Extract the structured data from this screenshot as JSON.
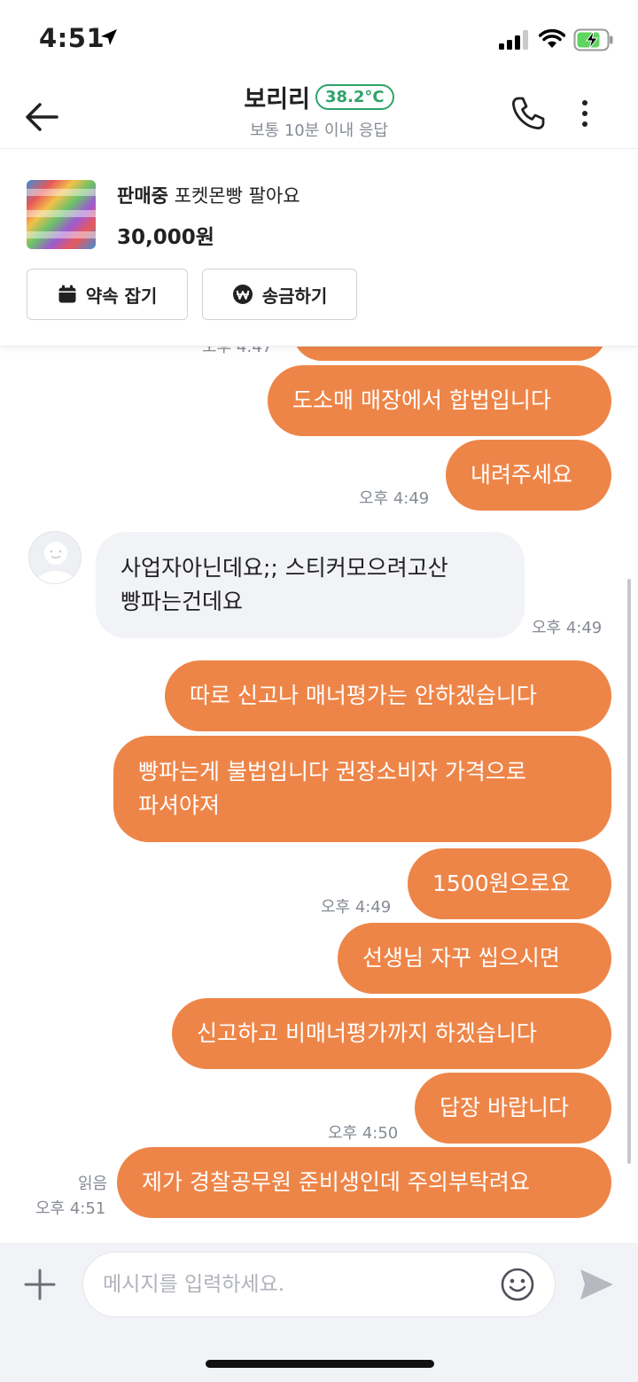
{
  "status_bar": {
    "time": "4:51"
  },
  "header": {
    "nickname": "보리리",
    "temperature": "38.2°C",
    "response_time": "보통 10분 이내 응답"
  },
  "product": {
    "status": "판매중",
    "title": "포켓몬빵 팔아요",
    "price": "30,000원",
    "appointment_label": "약속 잡기",
    "transfer_label": "송금하기"
  },
  "messages": [
    {
      "from": "me",
      "text": ""
    },
    {
      "from": "me",
      "text": "도소매 매장에서 합법입니다"
    },
    {
      "from": "me",
      "text": "내려주세요",
      "time": "오후 4:49"
    },
    {
      "from": "them",
      "text": "사업자아닌데요;; 스티커모으려고산\n빵파는건데요",
      "time": "오후 4:49"
    },
    {
      "from": "me",
      "text": "따로 신고나 매너평가는 안하겠습니다"
    },
    {
      "from": "me",
      "text": "빵파는게 불법입니다 권장소비자 가격으로\n파셔야져"
    },
    {
      "from": "me",
      "text": "1500원으로요",
      "time": "오후 4:49"
    },
    {
      "from": "me",
      "text": "선생님 자꾸 씹으시면"
    },
    {
      "from": "me",
      "text": "신고하고 비매너평가까지 하겠습니다"
    },
    {
      "from": "me",
      "text": "답장 바랍니다",
      "time": "오후 4:50"
    },
    {
      "from": "me",
      "text": "제가 경찰공무원 준비생인데 주의부탁려요",
      "time": "오후 4:51",
      "read": "읽음"
    }
  ],
  "partial_time_top": "오후 4:47",
  "input": {
    "placeholder": "메시지를 입력하세요."
  },
  "colors": {
    "accent": "#ee8548",
    "temperature_green": "#2ea36a",
    "other_bubble": "#f2f3f6"
  }
}
